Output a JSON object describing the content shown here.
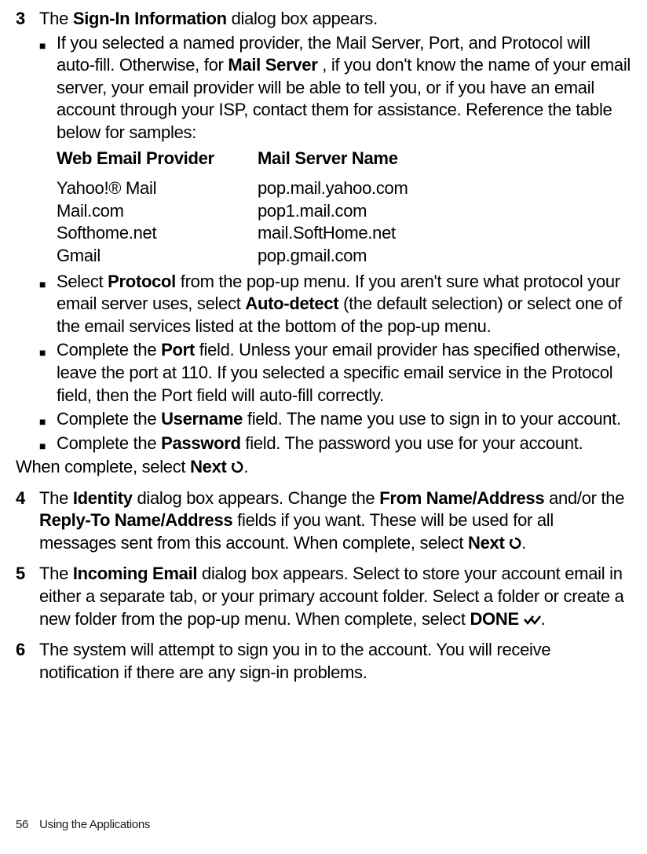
{
  "step3": {
    "num": "3",
    "intro_pre": "The ",
    "intro_bold": "Sign-In Information",
    "intro_post": " dialog box appears.",
    "bullet1": {
      "pre": "If you selected a named provider, the Mail Server, Port, and Protocol will auto-fill. Otherwise, for ",
      "bold": "Mail Server",
      "post": " , if you don't know the name of your email server, your email provider will be able to tell you, or if you have an email account through your ISP, contact them for assistance. Reference the table below for samples:"
    },
    "table": {
      "header1": "Web Email Provider",
      "header2": "Mail Server Name",
      "rows": [
        {
          "c1": "Yahoo!® Mail",
          "c2": "pop.mail.yahoo.com"
        },
        {
          "c1": "Mail.com",
          "c2": "pop1.mail.com"
        },
        {
          "c1": "Softhome.net",
          "c2": "mail.SoftHome.net"
        },
        {
          "c1": "Gmail",
          "c2": "pop.gmail.com"
        }
      ]
    },
    "bullet2": {
      "pre": "Select ",
      "bold1": "Protocol",
      "mid": " from the pop-up menu. If you aren't sure what protocol your email server uses, select ",
      "bold2": "Auto-detect",
      "post": " (the default selection) or select one of the email services listed at the bottom of the pop-up menu."
    },
    "bullet3": {
      "pre": "Complete the ",
      "bold": "Port",
      "post": " field. Unless your email provider has specified otherwise, leave the port at 110. If you selected a specific email service in the Protocol field, then the Port field will auto-fill correctly."
    },
    "bullet4": {
      "pre": "Complete the ",
      "bold": "Username",
      "post": " field. The name you use to sign in to your account."
    },
    "bullet5": {
      "pre": "Complete the ",
      "bold": "Password",
      "post": " field. The password you use for your account."
    },
    "closing": {
      "pre": "When complete, select ",
      "bold": "Next",
      "post": "."
    }
  },
  "step4": {
    "num": "4",
    "t1": "The ",
    "b1": "Identity",
    "t2": " dialog box appears. Change the ",
    "b2": "From Name/Address",
    "t3": " and/or the ",
    "b3": "Reply-To Name/Address",
    "t4": " fields if you want. These will be used  for all messages sent from this account. When complete, select ",
    "b4": "Next",
    "t5": "."
  },
  "step5": {
    "num": "5",
    "t1": "The ",
    "b1": "Incoming Email",
    "t2": " dialog box appears. Select to store your account email in either a separate tab, or your primary account folder. Select a folder or create a new folder from the pop-up menu. When complete, select ",
    "b2": "DONE",
    "t3": "."
  },
  "step6": {
    "num": "6",
    "text": "The system will attempt to sign you in to the account. You will receive notification if there are any sign-in problems."
  },
  "footer": {
    "page": "56",
    "section": "Using the Applications"
  }
}
